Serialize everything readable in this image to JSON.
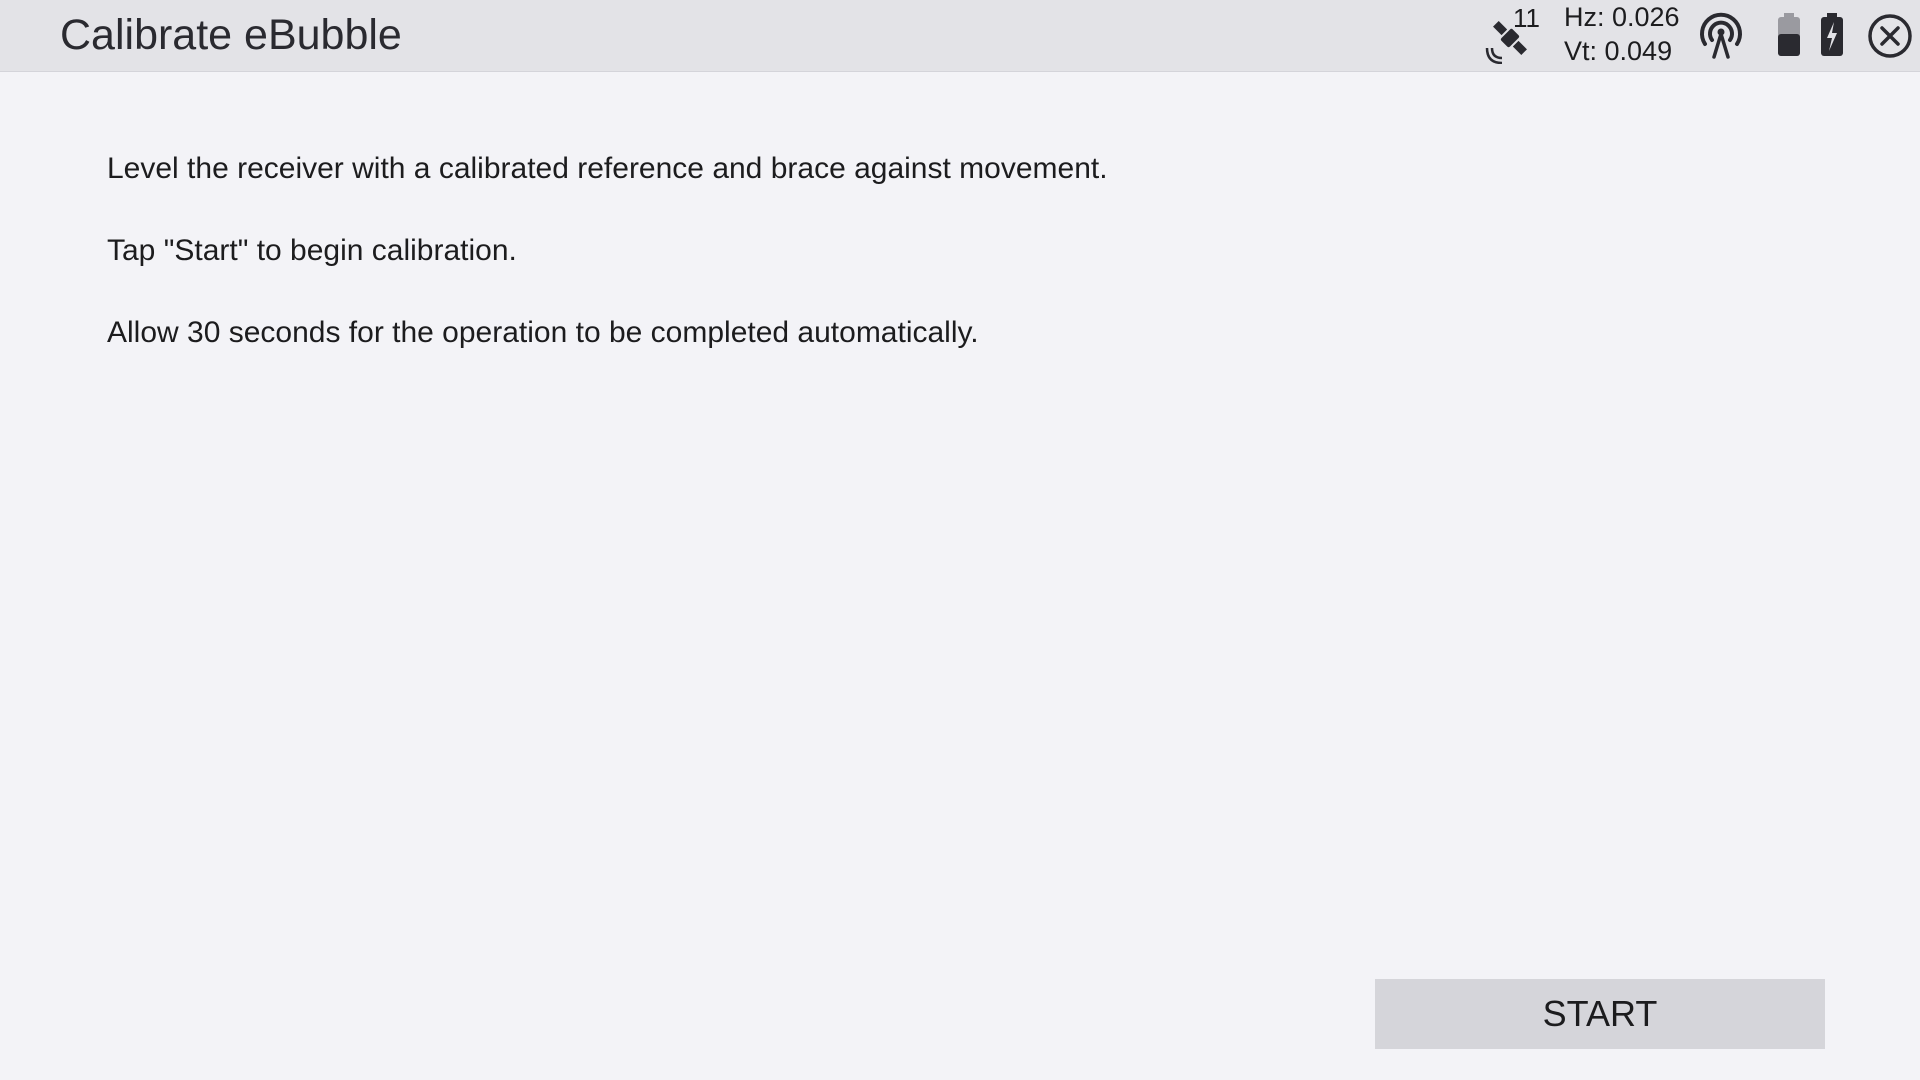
{
  "header": {
    "title": "Calibrate eBubble",
    "satellite_count": "11",
    "hz_precision": "Hz: 0.026",
    "vt_precision": "Vt: 0.049",
    "icons": [
      "satellite-icon",
      "radio-signal-icon",
      "battery-icon",
      "battery-charging-icon",
      "close-icon"
    ]
  },
  "instructions": [
    "Level the receiver with a calibrated reference and brace against movement.",
    "Tap \"Start\" to begin calibration.",
    "Allow 30 seconds for the operation to be completed automatically."
  ],
  "footer": {
    "start_label": "START"
  },
  "colors": {
    "background": "#f3f3f7",
    "titlebar": "#e3e3e7",
    "button": "#d5d5da",
    "text": "#1c1c1e"
  }
}
